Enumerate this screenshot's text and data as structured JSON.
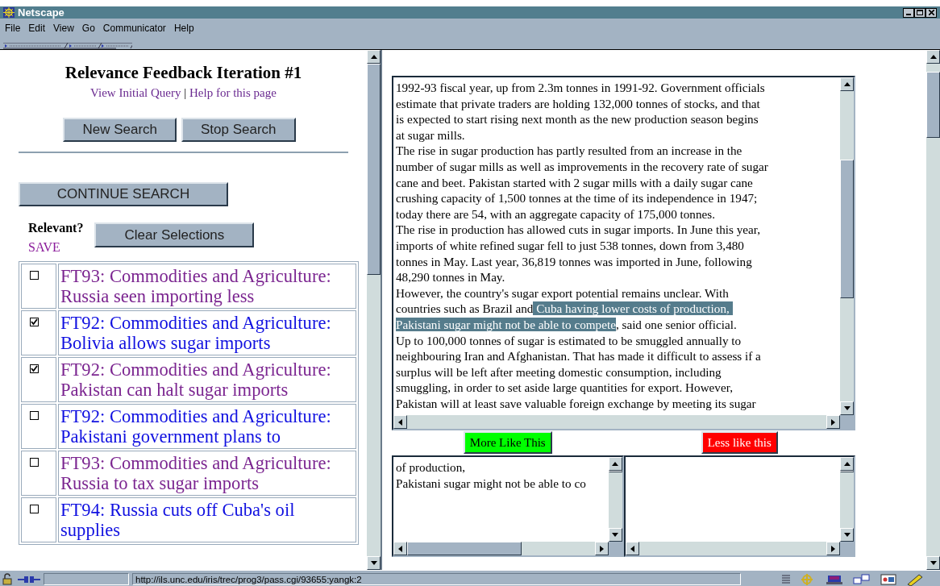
{
  "window": {
    "title": "Netscape"
  },
  "menu": [
    "File",
    "Edit",
    "View",
    "Go",
    "Communicator",
    "Help"
  ],
  "left_frame": {
    "heading": "Relevance Feedback Iteration #1",
    "links": [
      "View Initial Query",
      "Help for this page"
    ],
    "separator": "|",
    "buttons": [
      "New Search",
      "Stop Search"
    ],
    "continue_button": "CONTINUE SEARCH",
    "relevant_label": "Relevant?",
    "clear_button": "Clear Selections",
    "save_link": "SAVE",
    "results": [
      {
        "title": "FT93: Commodities and Agriculture: Russia seen importing less",
        "checked": false,
        "visited": true
      },
      {
        "title": "FT92: Commodities and Agriculture: Bolivia allows sugar imports",
        "checked": true,
        "visited": false
      },
      {
        "title": "FT92: Commodities and Agriculture: Pakistan can halt sugar imports",
        "checked": true,
        "visited": true
      },
      {
        "title": "FT92: Commodities and Agriculture: Pakistani government plans to",
        "checked": false,
        "visited": false
      },
      {
        "title": "FT93: Commodities and Agriculture: Russia to tax sugar imports",
        "checked": false,
        "visited": true
      },
      {
        "title": "FT94: Russia cuts off Cuba's oil supplies",
        "checked": false,
        "visited": false
      }
    ]
  },
  "right_frame": {
    "document_lines": [
      [
        {
          "text": "1992-93 fiscal year, up from 2.3m tonnes in 1991-92. Government officials",
          "selected": false
        }
      ],
      [
        {
          "text": "estimate that private traders are holding 132,000 tonnes of stocks, and that",
          "selected": false
        }
      ],
      [
        {
          "text": "is expected to start rising next month as the new production season begins",
          "selected": false
        }
      ],
      [
        {
          "text": "at sugar mills.",
          "selected": false
        }
      ],
      [
        {
          "text": "The rise in sugar production has partly resulted from an increase in the",
          "selected": false
        }
      ],
      [
        {
          "text": "number of sugar mills as well as improvements in the recovery rate of sugar",
          "selected": false
        }
      ],
      [
        {
          "text": "cane and beet. Pakistan started with 2 sugar mills with a daily sugar cane",
          "selected": false
        }
      ],
      [
        {
          "text": "crushing capacity of 1,500 tonnes at the time of its independence in 1947;",
          "selected": false
        }
      ],
      [
        {
          "text": "today there are 54, with an aggregate capacity of 175,000 tonnes.",
          "selected": false
        }
      ],
      [
        {
          "text": "The rise in production has allowed cuts in sugar imports. In June this year,",
          "selected": false
        }
      ],
      [
        {
          "text": "imports of white refined sugar fell to just 538 tonnes, down from 3,480",
          "selected": false
        }
      ],
      [
        {
          "text": "tonnes in May. Last year, 36,819 tonnes was imported in June, following",
          "selected": false
        }
      ],
      [
        {
          "text": "48,290 tonnes in May.",
          "selected": false
        }
      ],
      [
        {
          "text": "However, the country's sugar export potential remains unclear. With",
          "selected": false
        }
      ],
      [
        {
          "text": "countries such as Brazil and",
          "selected": false
        },
        {
          "text": " Cuba having lower costs of production, ",
          "selected": true
        }
      ],
      [
        {
          "text": "Pakistani sugar might not be able to compete",
          "selected": true
        },
        {
          "text": ", said one senior official.",
          "selected": false
        }
      ],
      [
        {
          "text": "Up to 100,000 tonnes of sugar is estimated to be smuggled annually to",
          "selected": false
        }
      ],
      [
        {
          "text": "neighbouring Iran and Afghanistan. That has made it difficult to assess if a",
          "selected": false
        }
      ],
      [
        {
          "text": "surplus will be left after meeting domestic consumption, including",
          "selected": false
        }
      ],
      [
        {
          "text": "smuggling, in order to set aside large quantities for export. However,",
          "selected": false
        }
      ],
      [
        {
          "text": "Pakistan will at least save valuable foreign exchange by meeting its sugar",
          "selected": false
        }
      ]
    ],
    "feedback": [
      {
        "button": "More Like This",
        "color": "#00ff00",
        "lines": [
          "of production,",
          "Pakistani sugar might not be able to co"
        ]
      },
      {
        "button": "Less like this",
        "color": "#ff0000"
      }
    ]
  },
  "status_bar": {
    "url": "http://ils.unc.edu/iris/trec/prog3/pass.cgi/93655:yangk:2"
  }
}
